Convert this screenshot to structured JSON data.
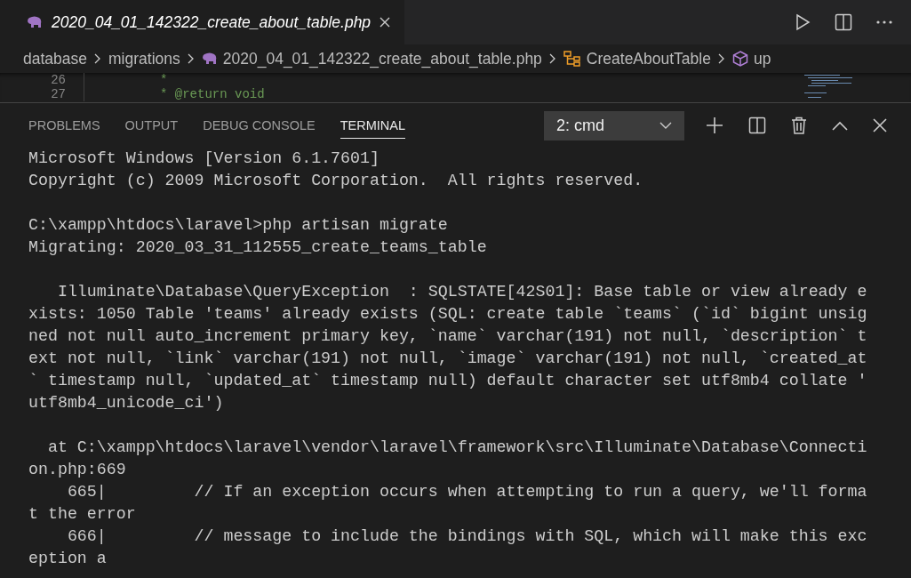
{
  "editor_tab": {
    "title": "2020_04_01_142322_create_about_table.php",
    "selected": true
  },
  "breadcrumbs": [
    {
      "label": "database",
      "kind": "folder"
    },
    {
      "label": "migrations",
      "kind": "folder"
    },
    {
      "label": "2020_04_01_142322_create_about_table.php",
      "kind": "file"
    },
    {
      "label": "CreateAboutTable",
      "kind": "class"
    },
    {
      "label": "up",
      "kind": "method"
    }
  ],
  "code_lines": [
    {
      "number": "26",
      "text": "*"
    },
    {
      "number": "27",
      "text": "* @return void"
    }
  ],
  "panel_tabs": [
    {
      "label": "PROBLEMS",
      "selected": false
    },
    {
      "label": "OUTPUT",
      "selected": false
    },
    {
      "label": "DEBUG CONSOLE",
      "selected": false
    },
    {
      "label": "TERMINAL",
      "selected": true
    }
  ],
  "terminal_select": {
    "value": "2: cmd"
  },
  "terminal_blocks": [
    [
      "Microsoft Windows [Version 6.1.7601]",
      "Copyright (c) 2009 Microsoft Corporation.  All rights reserved."
    ],
    [
      "C:\\xampp\\htdocs\\laravel>php artisan migrate",
      "Migrating: 2020_03_31_112555_create_teams_table"
    ],
    [
      "   Illuminate\\Database\\QueryException  : SQLSTATE[42S01]: Base table or view already e",
      "xists: 1050 Table 'teams' already exists (SQL: create table `teams` (`id` bigint unsig",
      "ned not null auto_increment primary key, `name` varchar(191) not null, `description` t",
      "ext not null, `link` varchar(191) not null, `image` varchar(191) not null, `created_at",
      "` timestamp null, `updated_at` timestamp null) default character set utf8mb4 collate '",
      "utf8mb4_unicode_ci')"
    ],
    [
      "  at C:\\xampp\\htdocs\\laravel\\vendor\\laravel\\framework\\src\\Illuminate\\Database\\Connecti",
      "on.php:669",
      "    665|         // If an exception occurs when attempting to run a query, we'll forma",
      "t the error",
      "    666|         // message to include the bindings with SQL, which will make this exc",
      "eption a"
    ]
  ]
}
